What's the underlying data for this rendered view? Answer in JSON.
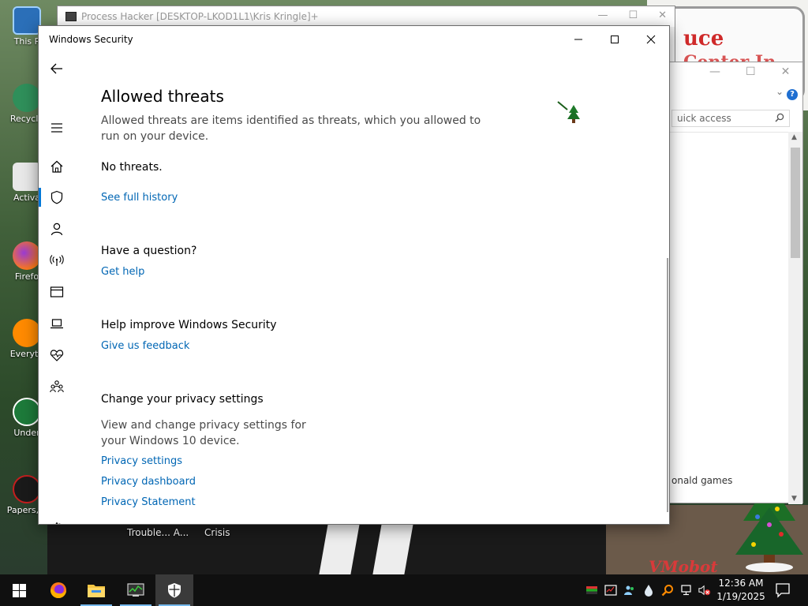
{
  "desktop": {
    "icons": [
      {
        "label": "This P"
      },
      {
        "label": "Recycle"
      },
      {
        "label": "Activa"
      },
      {
        "label": "Firefo"
      },
      {
        "label": "Everyth"
      },
      {
        "label": "Under"
      },
      {
        "label": "Papers, P"
      }
    ],
    "captions": [
      "Trouble... A...",
      "Crisis"
    ],
    "sign_line1": "uce",
    "sign_line2": "Center In",
    "stamp": "VMobot"
  },
  "process_hacker": {
    "title": "Process Hacker [DESKTOP-LKOD1L1\\Kris Kringle]+"
  },
  "explorer": {
    "search_placeholder": "uick access",
    "item": "onald games"
  },
  "windows_security": {
    "window_title": "Windows Security",
    "page_title": "Allowed threats",
    "description": "Allowed threats are items identified as threats, which you allowed to run on your device.",
    "no_threats": "No threats.",
    "see_full_history": "See full history",
    "question_heading": "Have a question?",
    "get_help": "Get help",
    "improve_heading": "Help improve Windows Security",
    "give_feedback": "Give us feedback",
    "privacy_heading": "Change your privacy settings",
    "privacy_desc": "View and change privacy settings for your Windows 10 device.",
    "privacy_settings": "Privacy settings",
    "privacy_dashboard": "Privacy dashboard",
    "privacy_statement": "Privacy Statement",
    "nav": [
      {
        "icon": "back-arrow-icon"
      },
      {
        "icon": "hamburger-menu-icon"
      },
      {
        "icon": "home-icon"
      },
      {
        "icon": "shield-icon",
        "active": true
      },
      {
        "icon": "person-icon"
      },
      {
        "icon": "wireless-antenna-icon"
      },
      {
        "icon": "app-browser-icon"
      },
      {
        "icon": "laptop-icon"
      },
      {
        "icon": "heart-pulse-icon"
      },
      {
        "icon": "family-icon"
      },
      {
        "icon": "gear-icon"
      }
    ],
    "accent_color": "#0078d7",
    "link_color": "#0066b4"
  },
  "taskbar": {
    "time": "12:36 AM",
    "date": "1/19/2025",
    "apps": [
      "firefox-icon",
      "file-explorer-icon",
      "process-hacker-icon",
      "windows-security-icon"
    ]
  }
}
